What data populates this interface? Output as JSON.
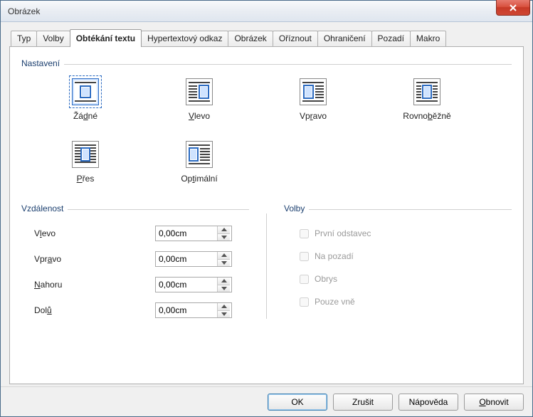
{
  "window": {
    "title": "Obrázek"
  },
  "tabs": [
    {
      "label": "Typ"
    },
    {
      "label": "Volby"
    },
    {
      "label": "Obtékání textu",
      "active": true
    },
    {
      "label": "Hypertextový odkaz"
    },
    {
      "label": "Obrázek"
    },
    {
      "label": "Oříznout"
    },
    {
      "label": "Ohraničení"
    },
    {
      "label": "Pozadí"
    },
    {
      "label": "Makro"
    }
  ],
  "settings_group": {
    "label": "Nastavení"
  },
  "wrap_options": {
    "none": {
      "label_pre": "Žá",
      "u": "d",
      "label_post": "né"
    },
    "left": {
      "label_pre": "",
      "u": "V",
      "label_post": "levo"
    },
    "right": {
      "label_pre": "Vp",
      "u": "r",
      "label_post": "avo"
    },
    "parallel": {
      "label_pre": "Rovno",
      "u": "b",
      "label_post": "ěžně"
    },
    "through": {
      "label_pre": "",
      "u": "P",
      "label_post": "řes"
    },
    "optimal": {
      "label_pre": "Op",
      "u": "t",
      "label_post": "imální"
    }
  },
  "distance_group": {
    "label": "Vzdálenost"
  },
  "distance": {
    "left": {
      "label_pre": "V",
      "u": "l",
      "label_post": "evo",
      "value": "0,00cm"
    },
    "right": {
      "label_pre": "Vpr",
      "u": "a",
      "label_post": "vo",
      "value": "0,00cm"
    },
    "top": {
      "label_pre": "",
      "u": "N",
      "label_post": "ahoru",
      "value": "0,00cm"
    },
    "bottom": {
      "label_pre": "Dol",
      "u": "ů",
      "label_post": "",
      "value": "0,00cm"
    }
  },
  "options_group": {
    "label": "Volby"
  },
  "options": {
    "first_para": "První odstavec",
    "background": "Na pozadí",
    "contour": "Obrys",
    "outside": "Pouze vně"
  },
  "buttons": {
    "ok": "OK",
    "cancel": "Zrušit",
    "help": "Nápověda",
    "reset_pre": "",
    "reset_u": "O",
    "reset_post": "bnovit"
  }
}
